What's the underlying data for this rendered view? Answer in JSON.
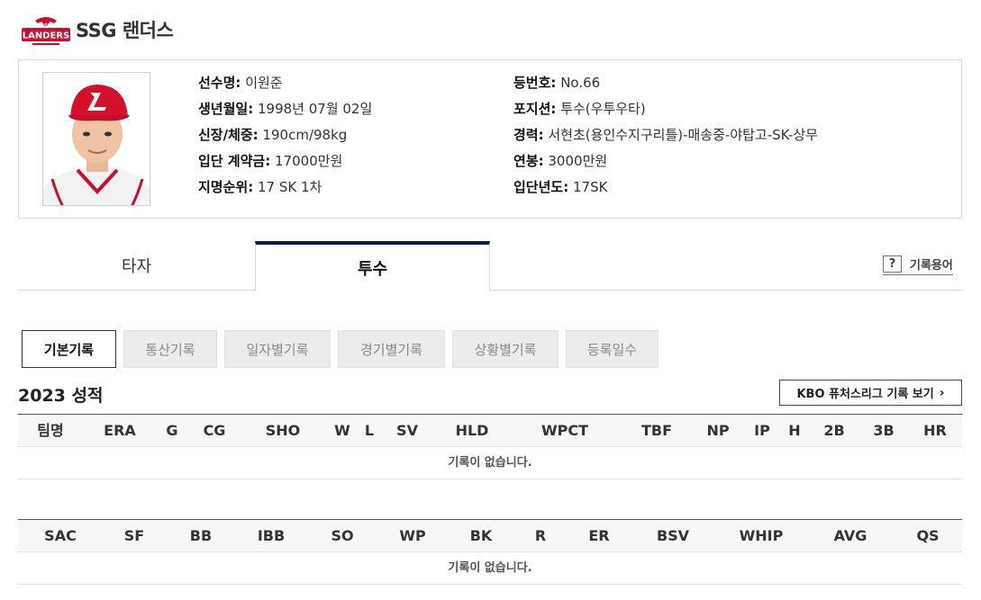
{
  "team": {
    "name": "SSG 랜더스",
    "logo_text": "LANDERS",
    "logo_small": "SSG",
    "brand_color": "#c8102e"
  },
  "player": {
    "fields_left": [
      {
        "label": "선수명:",
        "value": "이원준"
      },
      {
        "label": "생년월일:",
        "value": "1998년 07월 02일"
      },
      {
        "label": "신장/체중:",
        "value": "190cm/98kg"
      },
      {
        "label": "입단 계약금:",
        "value": "17000만원"
      },
      {
        "label": "지명순위:",
        "value": "17 SK 1차"
      }
    ],
    "fields_right": [
      {
        "label": "등번호:",
        "value": "No.66"
      },
      {
        "label": "포지션:",
        "value": "투수(우투우타)"
      },
      {
        "label": "경력:",
        "value": "서현초(용인수지구리틀)-매송중-야탑고-SK-상무"
      },
      {
        "label": "연봉:",
        "value": "3000만원"
      },
      {
        "label": "입단년도:",
        "value": "17SK"
      }
    ]
  },
  "tabs": {
    "batter": "타자",
    "pitcher": "투수",
    "active": "pitcher",
    "active_color": "#0e1c4b"
  },
  "glossary": {
    "icon": "?",
    "label": "기록용어"
  },
  "sub_tabs": {
    "items": [
      "기본기록",
      "통산기록",
      "일자별기록",
      "경기별기록",
      "상황별기록",
      "등록일수"
    ],
    "active_index": 0
  },
  "season": {
    "title": "2023 성적"
  },
  "kbo_link": {
    "label": "KBO 퓨처스리그 기록 보기",
    "icon": "chevron-right-icon"
  },
  "table1": {
    "columns": [
      "팀명",
      "ERA",
      "G",
      "CG",
      "SHO",
      "W",
      "L",
      "SV",
      "HLD",
      "WPCT",
      "TBF",
      "NP",
      "IP",
      "H",
      "2B",
      "3B",
      "HR"
    ],
    "empty_message": "기록이 없습니다."
  },
  "table2": {
    "columns": [
      "SAC",
      "SF",
      "BB",
      "IBB",
      "SO",
      "WP",
      "BK",
      "R",
      "ER",
      "BSV",
      "WHIP",
      "AVG",
      "QS"
    ],
    "empty_message": "기록이 없습니다."
  }
}
